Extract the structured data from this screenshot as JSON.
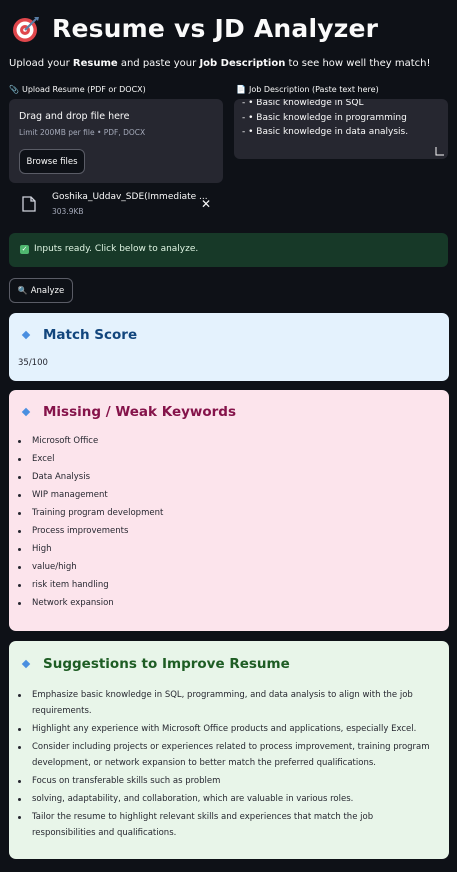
{
  "header": {
    "title": "Resume vs JD Analyzer",
    "title_icon": "target-dart-icon",
    "subtitle": {
      "p1": "Upload your ",
      "b1": "Resume",
      "p2": " and paste your ",
      "b2": "Job Description",
      "p3": " to see how well they match!"
    }
  },
  "upload": {
    "label": "Upload Resume (PDF or DOCX)",
    "drop_text": "Drag and drop file here",
    "limit_text": "Limit 200MB per file • PDF, DOCX",
    "browse_label": "Browse files",
    "file_name": "Goshika_Uddav_SDE(Immediate ...",
    "file_size": "303.9KB"
  },
  "jd": {
    "label": "Job Description (Paste text here)",
    "lines": [
      "- • Basic knowledge in SQL",
      "- • Basic knowledge in programming",
      "- • Basic knowledge in data analysis."
    ]
  },
  "status": {
    "text": "Inputs ready. Click below to analyze.",
    "color": "#173928"
  },
  "analyze_button": {
    "label": "Analyze",
    "icon": "magnifier-icon"
  },
  "match": {
    "title": "Match Score",
    "score": "35/100",
    "bg": "#e4f2fd"
  },
  "missing": {
    "title": "Missing / Weak Keywords",
    "bg": "#fce4ec",
    "items": [
      "Microsoft Office",
      "Excel",
      "Data Analysis",
      "WIP management",
      "Training program development",
      "Process improvements",
      "High",
      "value/high",
      "risk item handling",
      "Network expansion"
    ]
  },
  "suggestions": {
    "title": "Suggestions to Improve Resume",
    "bg": "#e8f5e9",
    "items": [
      "Emphasize basic knowledge in SQL, programming, and data analysis to align with the job requirements.",
      "Highlight any experience with Microsoft Office products and applications, especially Excel.",
      "Consider including projects or experiences related to process improvement, training program development, or network expansion to better match the preferred qualifications.",
      "Focus on transferable skills such as problem",
      "solving, adaptability, and collaboration, which are valuable in various roles.",
      "Tailor the resume to highlight relevant skills and experiences that match the job responsibilities and qualifications."
    ]
  }
}
